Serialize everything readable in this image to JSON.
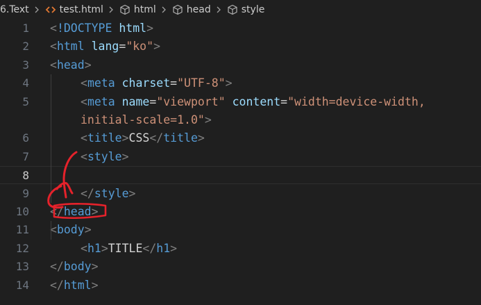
{
  "breadcrumb": {
    "items": [
      {
        "label": "6.Text",
        "icon": "folder"
      },
      {
        "label": "test.html",
        "icon": "html-file-icon"
      },
      {
        "label": "html",
        "icon": "cube-icon"
      },
      {
        "label": "head",
        "icon": "cube-icon"
      },
      {
        "label": "style",
        "icon": "cube-icon"
      }
    ]
  },
  "editor": {
    "active_line": 8,
    "lines": [
      {
        "num": "1",
        "tokens": [
          {
            "t": "br",
            "v": "<"
          },
          {
            "t": "tag",
            "v": "!DOCTYPE"
          },
          {
            "t": "txt",
            "v": " "
          },
          {
            "t": "attr",
            "v": "html"
          },
          {
            "t": "br",
            "v": ">"
          }
        ]
      },
      {
        "num": "2",
        "tokens": [
          {
            "t": "br",
            "v": "<"
          },
          {
            "t": "tag",
            "v": "html"
          },
          {
            "t": "txt",
            "v": " "
          },
          {
            "t": "attr",
            "v": "lang"
          },
          {
            "t": "txt",
            "v": "="
          },
          {
            "t": "str",
            "v": "\"ko\""
          },
          {
            "t": "br",
            "v": ">"
          }
        ]
      },
      {
        "num": "3",
        "tokens": [
          {
            "t": "br",
            "v": "<"
          },
          {
            "t": "tag",
            "v": "head"
          },
          {
            "t": "br",
            "v": ">"
          }
        ]
      },
      {
        "num": "4",
        "tokens": [
          {
            "t": "br",
            "v": "<"
          },
          {
            "t": "tag",
            "v": "meta"
          },
          {
            "t": "txt",
            "v": " "
          },
          {
            "t": "attr",
            "v": "charset"
          },
          {
            "t": "txt",
            "v": "="
          },
          {
            "t": "str",
            "v": "\"UTF-8\""
          },
          {
            "t": "br",
            "v": ">"
          }
        ]
      },
      {
        "num": "5",
        "tokens": [
          {
            "t": "br",
            "v": "<"
          },
          {
            "t": "tag",
            "v": "meta"
          },
          {
            "t": "txt",
            "v": " "
          },
          {
            "t": "attr",
            "v": "name"
          },
          {
            "t": "txt",
            "v": "="
          },
          {
            "t": "str",
            "v": "\"viewport\""
          },
          {
            "t": "txt",
            "v": " "
          },
          {
            "t": "attr",
            "v": "content"
          },
          {
            "t": "txt",
            "v": "="
          },
          {
            "t": "str",
            "v": "\"width=device-width,"
          }
        ]
      },
      {
        "num": "",
        "tokens": [
          {
            "t": "str",
            "v": "initial-scale=1.0\""
          },
          {
            "t": "br",
            "v": ">"
          }
        ]
      },
      {
        "num": "6",
        "tokens": [
          {
            "t": "br",
            "v": "<"
          },
          {
            "t": "tag",
            "v": "title"
          },
          {
            "t": "br",
            "v": ">"
          },
          {
            "t": "txt",
            "v": "CSS"
          },
          {
            "t": "br",
            "v": "</"
          },
          {
            "t": "tag",
            "v": "title"
          },
          {
            "t": "br",
            "v": ">"
          }
        ]
      },
      {
        "num": "7",
        "tokens": [
          {
            "t": "br",
            "v": "<"
          },
          {
            "t": "tag",
            "v": "style"
          },
          {
            "t": "br",
            "v": ">"
          }
        ]
      },
      {
        "num": "8",
        "tokens": []
      },
      {
        "num": "9",
        "tokens": [
          {
            "t": "br",
            "v": "</"
          },
          {
            "t": "tag",
            "v": "style"
          },
          {
            "t": "br",
            "v": ">"
          }
        ]
      },
      {
        "num": "10",
        "tokens": [
          {
            "t": "br",
            "v": "</"
          },
          {
            "t": "tag",
            "v": "head"
          },
          {
            "t": "br",
            "v": ">"
          }
        ]
      },
      {
        "num": "11",
        "tokens": [
          {
            "t": "br",
            "v": "<"
          },
          {
            "t": "tag",
            "v": "body"
          },
          {
            "t": "br",
            "v": ">"
          }
        ]
      },
      {
        "num": "12",
        "tokens": [
          {
            "t": "br",
            "v": "<"
          },
          {
            "t": "tag",
            "v": "h1"
          },
          {
            "t": "br",
            "v": ">"
          },
          {
            "t": "txt",
            "v": "TITLE"
          },
          {
            "t": "br",
            "v": "</"
          },
          {
            "t": "tag",
            "v": "h1"
          },
          {
            "t": "br",
            "v": ">"
          }
        ]
      },
      {
        "num": "13",
        "tokens": [
          {
            "t": "br",
            "v": "</"
          },
          {
            "t": "tag",
            "v": "body"
          },
          {
            "t": "br",
            "v": ">"
          }
        ]
      },
      {
        "num": "14",
        "tokens": [
          {
            "t": "br",
            "v": "</"
          },
          {
            "t": "tag",
            "v": "html"
          },
          {
            "t": "br",
            "v": ">"
          }
        ]
      }
    ]
  },
  "colors": {
    "background": "#1f1f1f",
    "tag": "#569cd6",
    "attribute": "#9cdcfe",
    "string": "#ce9178",
    "bracket": "#808080",
    "annotation": "#e5222b"
  }
}
